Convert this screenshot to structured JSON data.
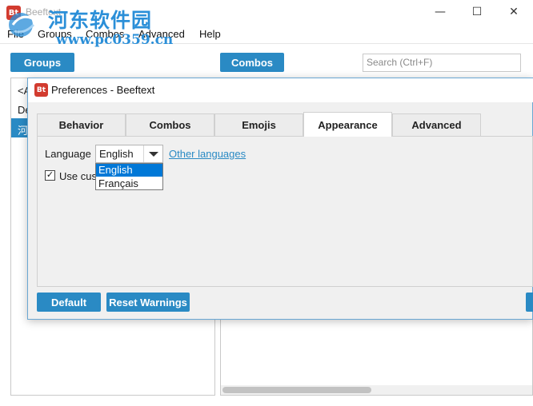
{
  "window": {
    "title": "Beeftext",
    "app_icon": "Bt"
  },
  "menu": [
    "File",
    "Groups",
    "Combos",
    "Advanced",
    "Help"
  ],
  "toolbar": {
    "groups_label": "Groups",
    "combos_label": "Combos",
    "search_placeholder": "Search (Ctrl+F)"
  },
  "left_list": {
    "item_partial_1": "<A",
    "item_partial_2": "De",
    "item_partial_3": "河"
  },
  "watermark": {
    "text": "河东软件园",
    "url": "www.pc0359.cn"
  },
  "dialog": {
    "title": "Preferences - Beeftext",
    "icon": "Bt",
    "tabs": [
      "Behavior",
      "Combos",
      "Emojis",
      "Appearance",
      "Advanced"
    ],
    "active_tab": "Appearance",
    "language_label": "Language",
    "language_value": "English",
    "other_languages_link": "Other languages",
    "language_options": [
      "English",
      "Français"
    ],
    "use_custom_label": "Use cus",
    "use_custom_checked": true,
    "default_button": "Default",
    "reset_warnings_button": "Reset Warnings"
  },
  "colors": {
    "accent": "#2a8ac4",
    "brand_red": "#d23b2f",
    "selection": "#0078d7"
  }
}
